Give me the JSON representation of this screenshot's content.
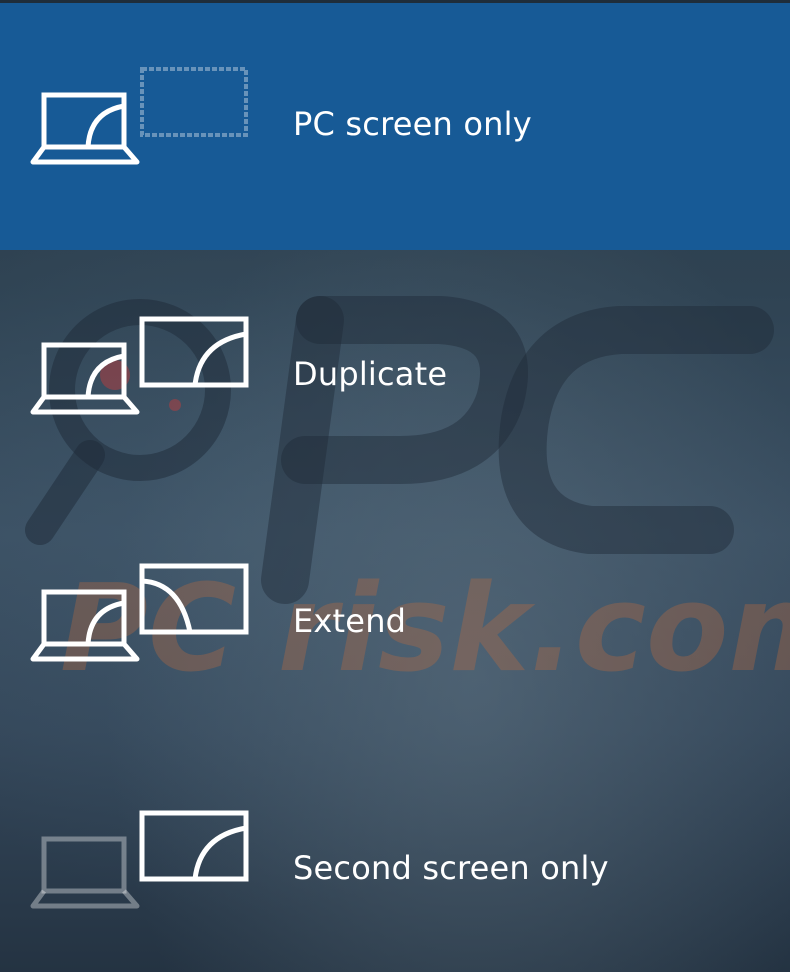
{
  "project_menu": {
    "options": [
      {
        "label": "PC screen only",
        "icon": "pc-screen-only-icon",
        "selected": true
      },
      {
        "label": "Duplicate",
        "icon": "duplicate-icon",
        "selected": false
      },
      {
        "label": "Extend",
        "icon": "extend-icon",
        "selected": false
      },
      {
        "label": "Second screen only",
        "icon": "second-screen-only-icon",
        "selected": false
      }
    ],
    "selected_color": "#175a96",
    "background_color": "#2f4353"
  },
  "watermark": {
    "text": "PC risk.com"
  }
}
